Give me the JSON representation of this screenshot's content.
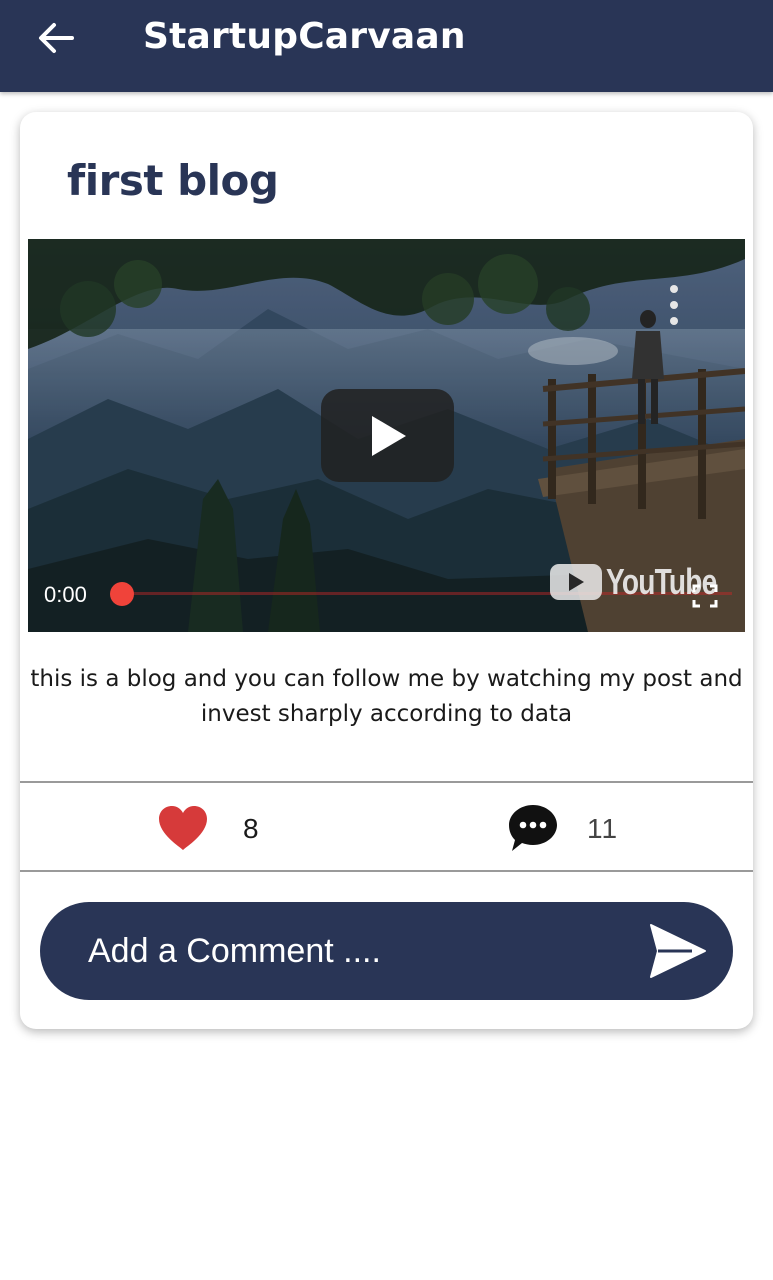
{
  "appbar": {
    "title": "StartupCarvaan",
    "back_icon": "arrow-left-icon"
  },
  "post": {
    "title": "first blog",
    "video": {
      "current_time": "0:00",
      "progress": 0,
      "provider": "YouTube",
      "play_icon": "play-icon",
      "more_icon": "more-vertical-icon",
      "fullscreen_icon": "fullscreen-icon"
    },
    "body": "this is a blog and you can follow me by watching my post and invest sharply according to data",
    "likes": {
      "count": "8",
      "icon": "heart-icon",
      "color": "#d63a3a"
    },
    "comments": {
      "count": "11",
      "icon": "comment-bubble-icon"
    }
  },
  "comment_box": {
    "placeholder": "Add a Comment ....",
    "value": "",
    "send_icon": "send-icon"
  },
  "colors": {
    "primary": "#293556",
    "accent_red": "#f0433a",
    "background": "#ffffff"
  }
}
